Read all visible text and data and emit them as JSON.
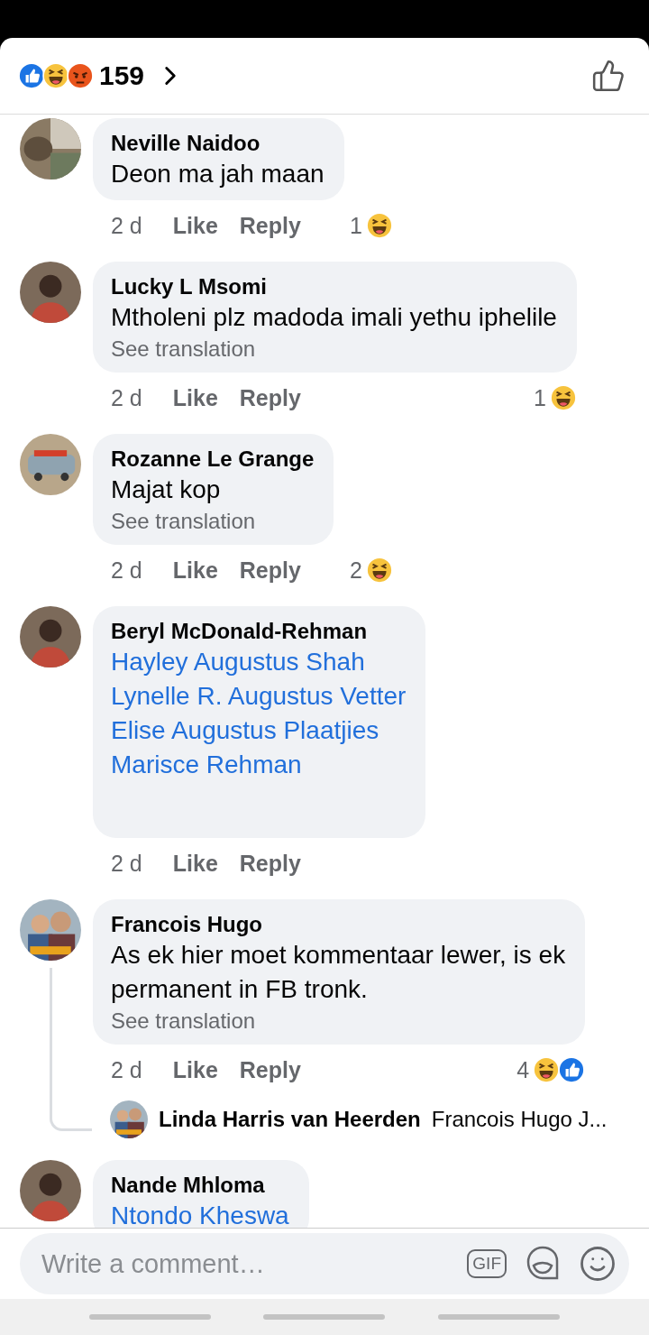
{
  "header": {
    "reactions": [
      {
        "kind": "like"
      },
      {
        "kind": "haha"
      },
      {
        "kind": "angry"
      }
    ],
    "count": "159"
  },
  "comments": [
    {
      "name": "Neville Naidoo",
      "body": "Deon ma jah maan",
      "time": "2 d",
      "like": "Like",
      "reply": "Reply",
      "reaction_count": "1",
      "reactions": [
        {
          "kind": "haha"
        }
      ]
    },
    {
      "name": "Lucky L Msomi",
      "body": "Mtholeni plz madoda imali yethu iphelile",
      "see_translation": "See translation",
      "time": "2 d",
      "like": "Like",
      "reply": "Reply",
      "reaction_count": "1",
      "reactions": [
        {
          "kind": "haha"
        }
      ]
    },
    {
      "name": "Rozanne Le Grange",
      "body": "Majat kop",
      "see_translation": "See translation",
      "time": "2 d",
      "like": "Like",
      "reply": "Reply",
      "reaction_count": "2",
      "reactions": [
        {
          "kind": "haha"
        }
      ]
    },
    {
      "name": "Beryl McDonald-Rehman",
      "links": [
        "Hayley Augustus Shah",
        "Lynelle R. Augustus Vetter",
        "Elise Augustus Plaatjies",
        "Marisce Rehman"
      ],
      "time": "2 d",
      "like": "Like",
      "reply": "Reply"
    },
    {
      "name": "Francois Hugo",
      "body": "As ek hier moet kommentaar lewer, is ek\npermanent in FB tronk.",
      "see_translation": "See translation",
      "time": "2 d",
      "like": "Like",
      "reply": "Reply",
      "reaction_count": "4",
      "reactions": [
        {
          "kind": "haha"
        },
        {
          "kind": "like"
        }
      ],
      "reply_preview": {
        "name": "Linda Harris van Heerden",
        "text": "Francois Hugo J..."
      }
    },
    {
      "name": "Nande Mhloma",
      "links": [
        "Ntondo Kheswa"
      ]
    }
  ],
  "composer": {
    "placeholder": "Write a comment…",
    "gif_label": "GIF"
  }
}
